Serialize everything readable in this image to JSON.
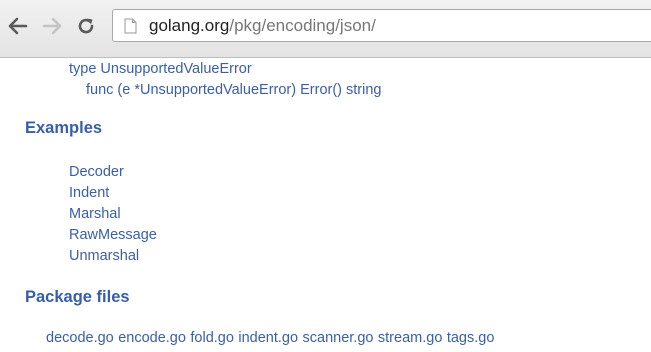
{
  "browser": {
    "address_domain": "golang.org",
    "address_path": "/pkg/encoding/json/"
  },
  "index": {
    "type_entry": "type UnsupportedValueError",
    "func_entry": "func (e *UnsupportedValueError) Error() string"
  },
  "examples": {
    "heading": "Examples",
    "items": [
      "Decoder",
      "Indent",
      "Marshal",
      "RawMessage",
      "Unmarshal"
    ]
  },
  "package_files": {
    "heading": "Package files",
    "files": [
      "decode.go",
      "encode.go",
      "fold.go",
      "indent.go",
      "scanner.go",
      "stream.go",
      "tags.go"
    ]
  }
}
